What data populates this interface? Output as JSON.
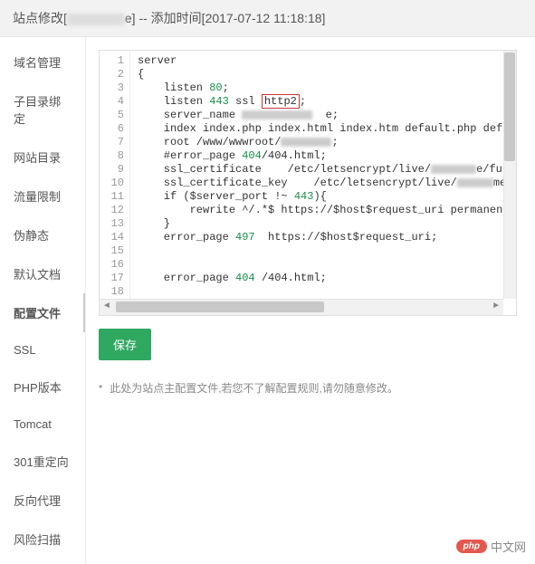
{
  "header": {
    "prefix": "站点修改[",
    "middle": "e] -- 添加时间[",
    "time": "2017-07-12 11:18:18",
    "suffix": "]"
  },
  "sidebar": {
    "items": [
      {
        "label": "域名管理"
      },
      {
        "label": "子目录绑定"
      },
      {
        "label": "网站目录"
      },
      {
        "label": "流量限制"
      },
      {
        "label": "伪静态"
      },
      {
        "label": "默认文档"
      },
      {
        "label": "配置文件"
      },
      {
        "label": "SSL"
      },
      {
        "label": "PHP版本"
      },
      {
        "label": "Tomcat"
      },
      {
        "label": "301重定向"
      },
      {
        "label": "反向代理"
      },
      {
        "label": "风险扫描"
      }
    ],
    "active_index": 6
  },
  "editor": {
    "gutter": [
      "1",
      "2",
      "3",
      "4",
      "5",
      "6",
      "7",
      "8",
      "9",
      "10",
      "11",
      "12",
      "13",
      "14",
      "15",
      "16",
      "17",
      "18"
    ],
    "code": [
      {
        "t": "server"
      },
      {
        "t": "{"
      },
      {
        "t": "    listen ",
        "n": "80",
        "tail": ";"
      },
      {
        "t": "    listen ",
        "n": "443",
        "tail": " ssl ",
        "box": "http2",
        "tail2": ";"
      },
      {
        "t": "    server_name ",
        "blur_w": 78,
        "tail": "  e;"
      },
      {
        "t": "    index index.php index.html index.htm default.php default.htm defau"
      },
      {
        "t": "    root /www/wwwroot/",
        "blur_w": 56,
        "tail": ";"
      },
      {
        "t": "    #error_page ",
        "n": "404",
        "tail": "/404.html;"
      },
      {
        "t": "    ssl_certificate    /etc/letsencrypt/live/",
        "blur_w": 50,
        "tail": "e/fullchain.pem"
      },
      {
        "t": "    ssl_certificate_key    /etc/letsencrypt/live/",
        "blur_w": 40,
        "tail": "me/privkey.p"
      },
      {
        "t": "    if ($server_port !~ ",
        "n": "443",
        "tail": "){"
      },
      {
        "t": "        rewrite ^/.*$ https://$host$request_uri permanent;"
      },
      {
        "t": "    }"
      },
      {
        "t": "    error_page ",
        "n": "497",
        "tail": "  https://$host$request_uri;"
      },
      {
        "t": ""
      },
      {
        "t": ""
      },
      {
        "t": "    error_page ",
        "n": "404",
        "tail": " /404.html;"
      },
      {
        "t": ""
      }
    ]
  },
  "buttons": {
    "save": "保存"
  },
  "tip": {
    "bullet": "•",
    "text": "此处为站点主配置文件,若您不了解配置规则,请勿随意修改。"
  },
  "footer": {
    "logo": "php",
    "text": "中文网"
  },
  "chart_data": null
}
